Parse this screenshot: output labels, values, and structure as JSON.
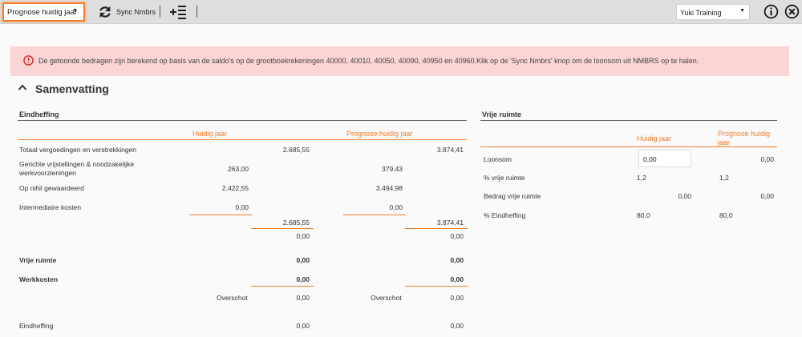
{
  "toolbar": {
    "year_dropdown": "Prognose huidig jaar",
    "sync_label": "Sync Nmbrs",
    "company_dropdown": "Yuki Training"
  },
  "alert": {
    "text": "De getoonde bedragen zijn berekend op basis van de saldo's op de grootboekrekeningen 40000, 40010, 40050, 40090, 40950 en 40960.Klik op de 'Sync Nmbrs' knop om de loonsom uit NMBRS op te halen."
  },
  "section": {
    "title": "Samenvatting"
  },
  "eindheffing": {
    "title": "Eindheffing",
    "col_current": "Huidig jaar",
    "col_forecast": "Prognose huidig jaar",
    "rows": {
      "totaal_label": "Totaal vergoedingen en verstrekkingen",
      "totaal_current": "2.685,55",
      "totaal_forecast": "3.874,41",
      "gericht_label_1": "Gerichte vrijstellingen & noodzakelijke",
      "gericht_label_2": "werkvoorzieningen",
      "gericht_current": "263,00",
      "gericht_forecast": "379,43",
      "nihil_label": "Op nihil gewaardeerd",
      "nihil_current": "2.422,55",
      "nihil_forecast": "3.494,98",
      "intermediair_label": "Intermediaire kosten",
      "intermediair_current": "0,00",
      "intermediair_forecast": "0,00",
      "subtotal_current": "2.685,55",
      "subtotal_forecast": "3.874,41",
      "diff_current": "0,00",
      "diff_forecast": "0,00",
      "vrije_label": "Vrije ruimte",
      "vrije_current": "0,00",
      "vrije_forecast": "0,00",
      "werk_label": "Werkkosten",
      "werk_current": "0,00",
      "werk_forecast": "0,00",
      "overschot_label_current": "Overschot",
      "overschot_current": "0,00",
      "overschot_label_forecast": "Overschot",
      "overschot_forecast": "0,00",
      "eind_label": "Eindheffing",
      "eind_current": "0,00",
      "eind_forecast": "0,00"
    }
  },
  "vrije_ruimte": {
    "title": "Vrije ruimte",
    "col_current": "Huidig jaar",
    "col_forecast_1": "Prognose huidig",
    "col_forecast_2": "jaar",
    "loonsom_label": "Loonsom",
    "loonsom_input": "0,00",
    "loonsom_forecast": "0,00",
    "pct_vrije_label": "% vrije ruimte",
    "pct_vrije_current": "1,2",
    "pct_vrije_forecast": "1,2",
    "bedrag_label": "Bedrag vrije ruimte",
    "bedrag_current": "0,00",
    "bedrag_forecast": "0,00",
    "pct_eind_label": "% Eindheffing",
    "pct_eind_current": "80,0",
    "pct_eind_forecast": "80,0"
  },
  "colors": {
    "accent": "#f07d2b",
    "alert_bg": "#fbd4d4",
    "alert_icon": "#d32f2f"
  },
  "icons": [
    "sync-icon",
    "add-list-icon",
    "info-icon",
    "close-icon",
    "alert-icon",
    "chevron-up-icon"
  ]
}
